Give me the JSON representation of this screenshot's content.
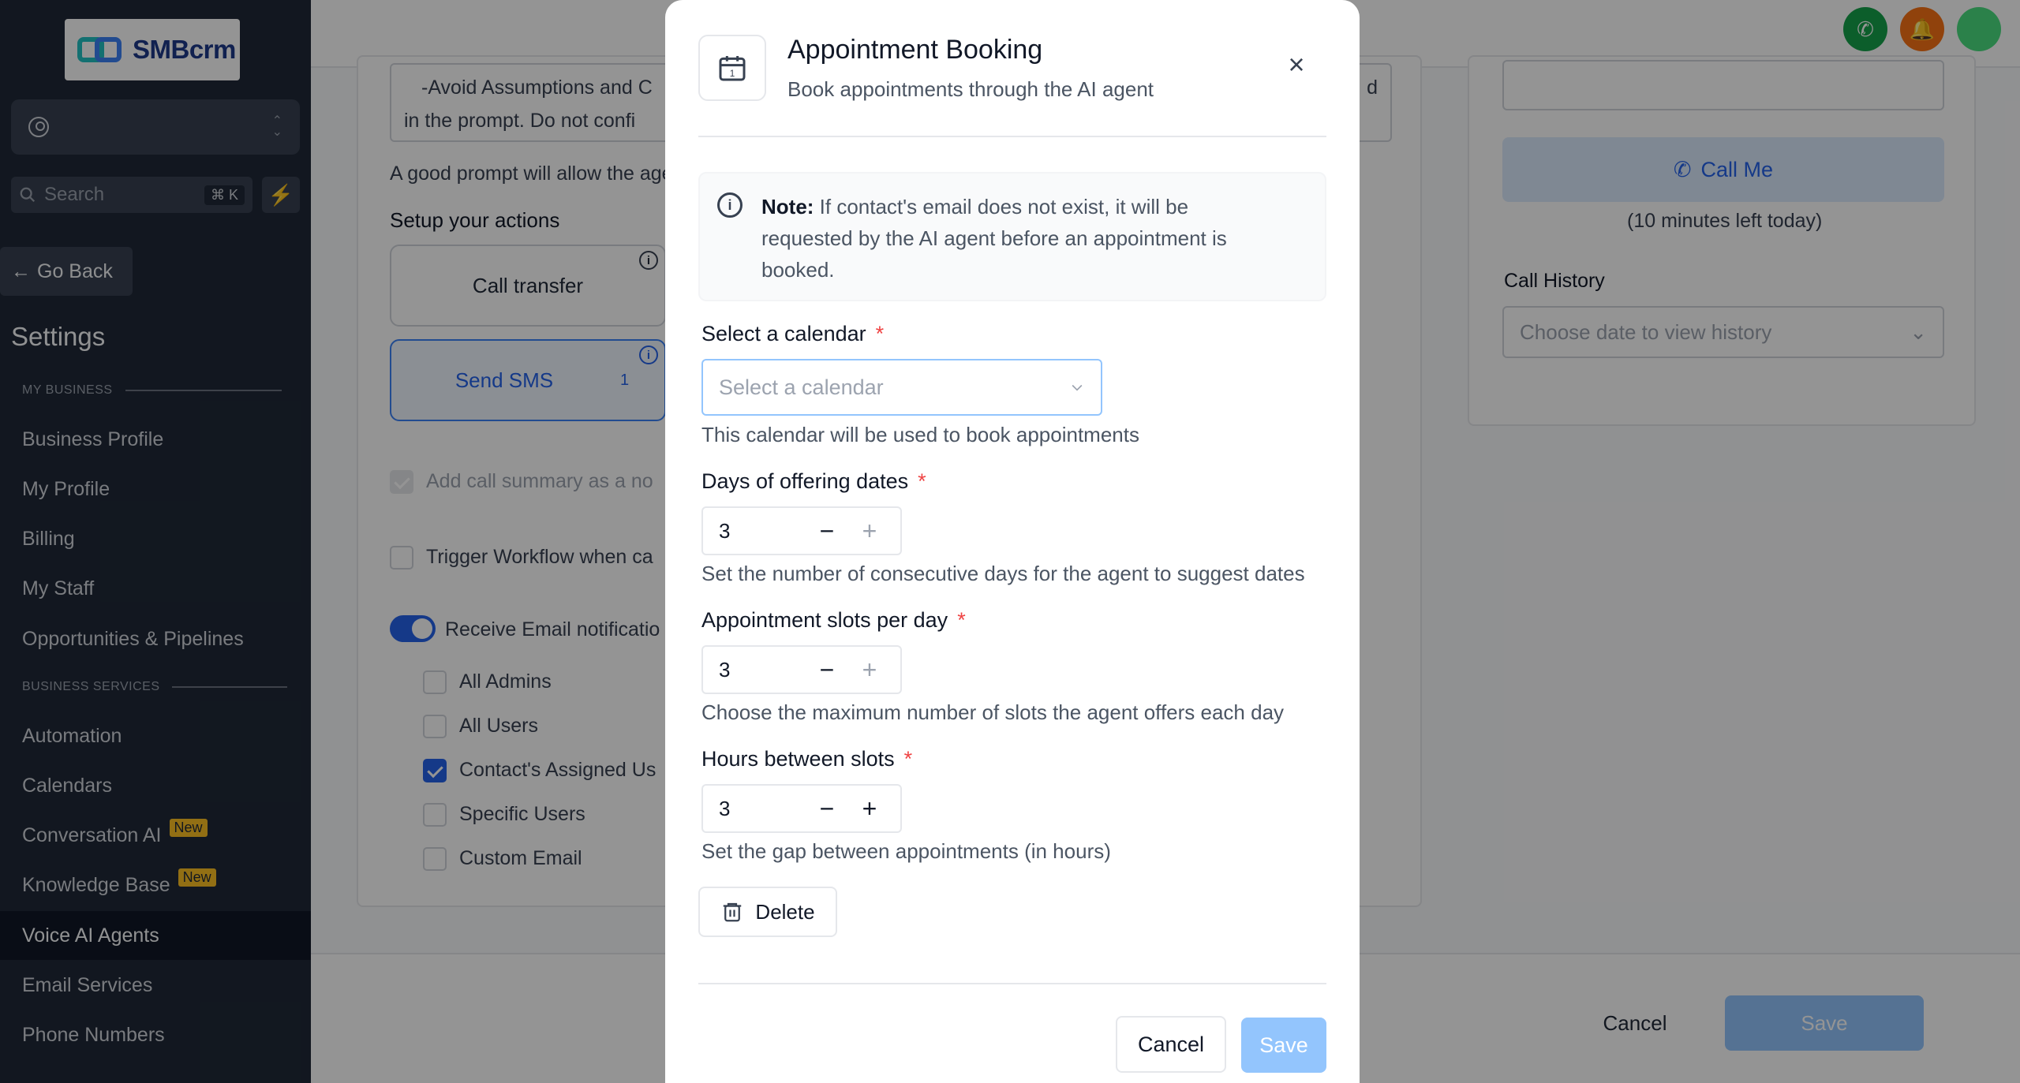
{
  "app": {
    "logo_text": "SMBcrm"
  },
  "sidebar": {
    "search_placeholder": "Search",
    "search_shortcut": "⌘ K",
    "go_back": "Go Back",
    "settings_title": "Settings",
    "section_business": "MY BUSINESS",
    "section_services": "BUSINESS SERVICES",
    "items": [
      {
        "label": "Business Profile",
        "badge": ""
      },
      {
        "label": "My Profile",
        "badge": ""
      },
      {
        "label": "Billing",
        "badge": ""
      },
      {
        "label": "My Staff",
        "badge": ""
      },
      {
        "label": "Opportunities & Pipelines",
        "badge": ""
      },
      {
        "label": "Automation",
        "badge": ""
      },
      {
        "label": "Calendars",
        "badge": ""
      },
      {
        "label": "Conversation AI",
        "badge": "New"
      },
      {
        "label": "Knowledge Base",
        "badge": "New"
      },
      {
        "label": "Voice AI Agents",
        "badge": ""
      },
      {
        "label": "Email Services",
        "badge": ""
      },
      {
        "label": "Phone Numbers",
        "badge": ""
      }
    ]
  },
  "background": {
    "prompt_line1": "-Avoid Assumptions and C",
    "prompt_line1_end": "d",
    "prompt_line2": "in the prompt. Do not confi",
    "prompt_hint": "A good prompt will allow the age",
    "actions_title": "Setup your actions",
    "action_call_transfer": "Call transfer",
    "action_send_sms": "Send SMS",
    "action_send_sms_count": "1",
    "add_summary": "Add call summary as a no",
    "trigger_workflow": "Trigger Workflow when ca",
    "receive_email": "Receive Email notificatio",
    "recipients": [
      {
        "label": "All Admins",
        "checked": false
      },
      {
        "label": "All Users",
        "checked": false
      },
      {
        "label": "Contact's Assigned Us",
        "checked": true
      },
      {
        "label": "Specific Users",
        "checked": false
      },
      {
        "label": "Custom Email",
        "checked": false
      }
    ],
    "call_me": "Call Me",
    "minutes_left": "(10 minutes left today)",
    "call_history": "Call History",
    "history_placeholder": "Choose date to view history",
    "cancel": "Cancel",
    "save": "Save"
  },
  "modal": {
    "title": "Appointment Booking",
    "subtitle": "Book appointments through the AI agent",
    "note_label": "Note:",
    "note_text": " If contact's email does not exist, it will be requested by the AI agent before an appointment is booked.",
    "calendar_label": "Select a calendar",
    "calendar_placeholder": "Select a calendar",
    "calendar_help": "This calendar will be used to book appointments",
    "days_label": "Days of offering dates",
    "days_value": "3",
    "days_help": "Set the number of consecutive days for the agent to suggest dates",
    "slots_label": "Appointment slots per day",
    "slots_value": "3",
    "slots_help": "Choose the maximum number of slots the agent offers each day",
    "hours_label": "Hours between slots",
    "hours_value": "3",
    "hours_help": "Set the gap between appointments (in hours)",
    "required_mark": "*",
    "delete": "Delete",
    "cancel": "Cancel",
    "save": "Save"
  },
  "colors": {
    "accent": "#2563eb",
    "sidebar_bg": "#1f2937",
    "required": "#ef4444",
    "save_disabled": "#93c5fd"
  }
}
